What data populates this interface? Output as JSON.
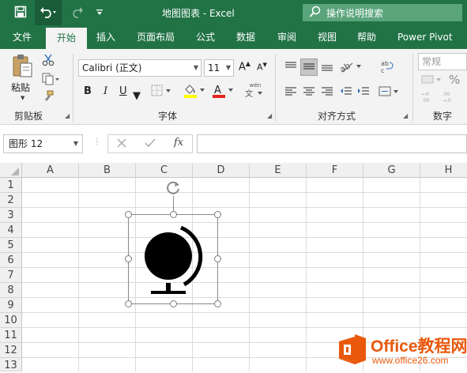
{
  "window": {
    "title": "地图图表 - Excel"
  },
  "tell_me": {
    "placeholder": "操作说明搜索"
  },
  "tabs": [
    {
      "label": "文件"
    },
    {
      "label": "开始"
    },
    {
      "label": "插入"
    },
    {
      "label": "页面布局"
    },
    {
      "label": "公式"
    },
    {
      "label": "数据"
    },
    {
      "label": "审阅"
    },
    {
      "label": "视图"
    },
    {
      "label": "帮助"
    },
    {
      "label": "Power Pivot"
    }
  ],
  "ribbon": {
    "clipboard": {
      "paste_label": "粘贴",
      "group_label": "剪贴板"
    },
    "font": {
      "font_name": "Calibri (正文)",
      "font_size": "11",
      "bold": "B",
      "italic": "I",
      "underline": "U",
      "wen": "wén",
      "group_label": "字体"
    },
    "alignment": {
      "group_label": "对齐方式"
    },
    "number": {
      "format": "常规",
      "percent": "%",
      "group_label": "数字"
    }
  },
  "formula_bar": {
    "name_box": "图形 12",
    "fx": "fx",
    "value": ""
  },
  "columns": [
    "A",
    "B",
    "C",
    "D",
    "E",
    "F",
    "G",
    "H"
  ],
  "rows": [
    "1",
    "2",
    "3",
    "4",
    "5",
    "6",
    "7",
    "8",
    "9",
    "10",
    "11",
    "12",
    "13"
  ],
  "watermark": {
    "line1": "Office教程网",
    "line2": "www.office26.com"
  },
  "colors": {
    "excel_green": "#217346",
    "accent_red": "#e3261c",
    "watermark_orange": "#e8590c"
  }
}
